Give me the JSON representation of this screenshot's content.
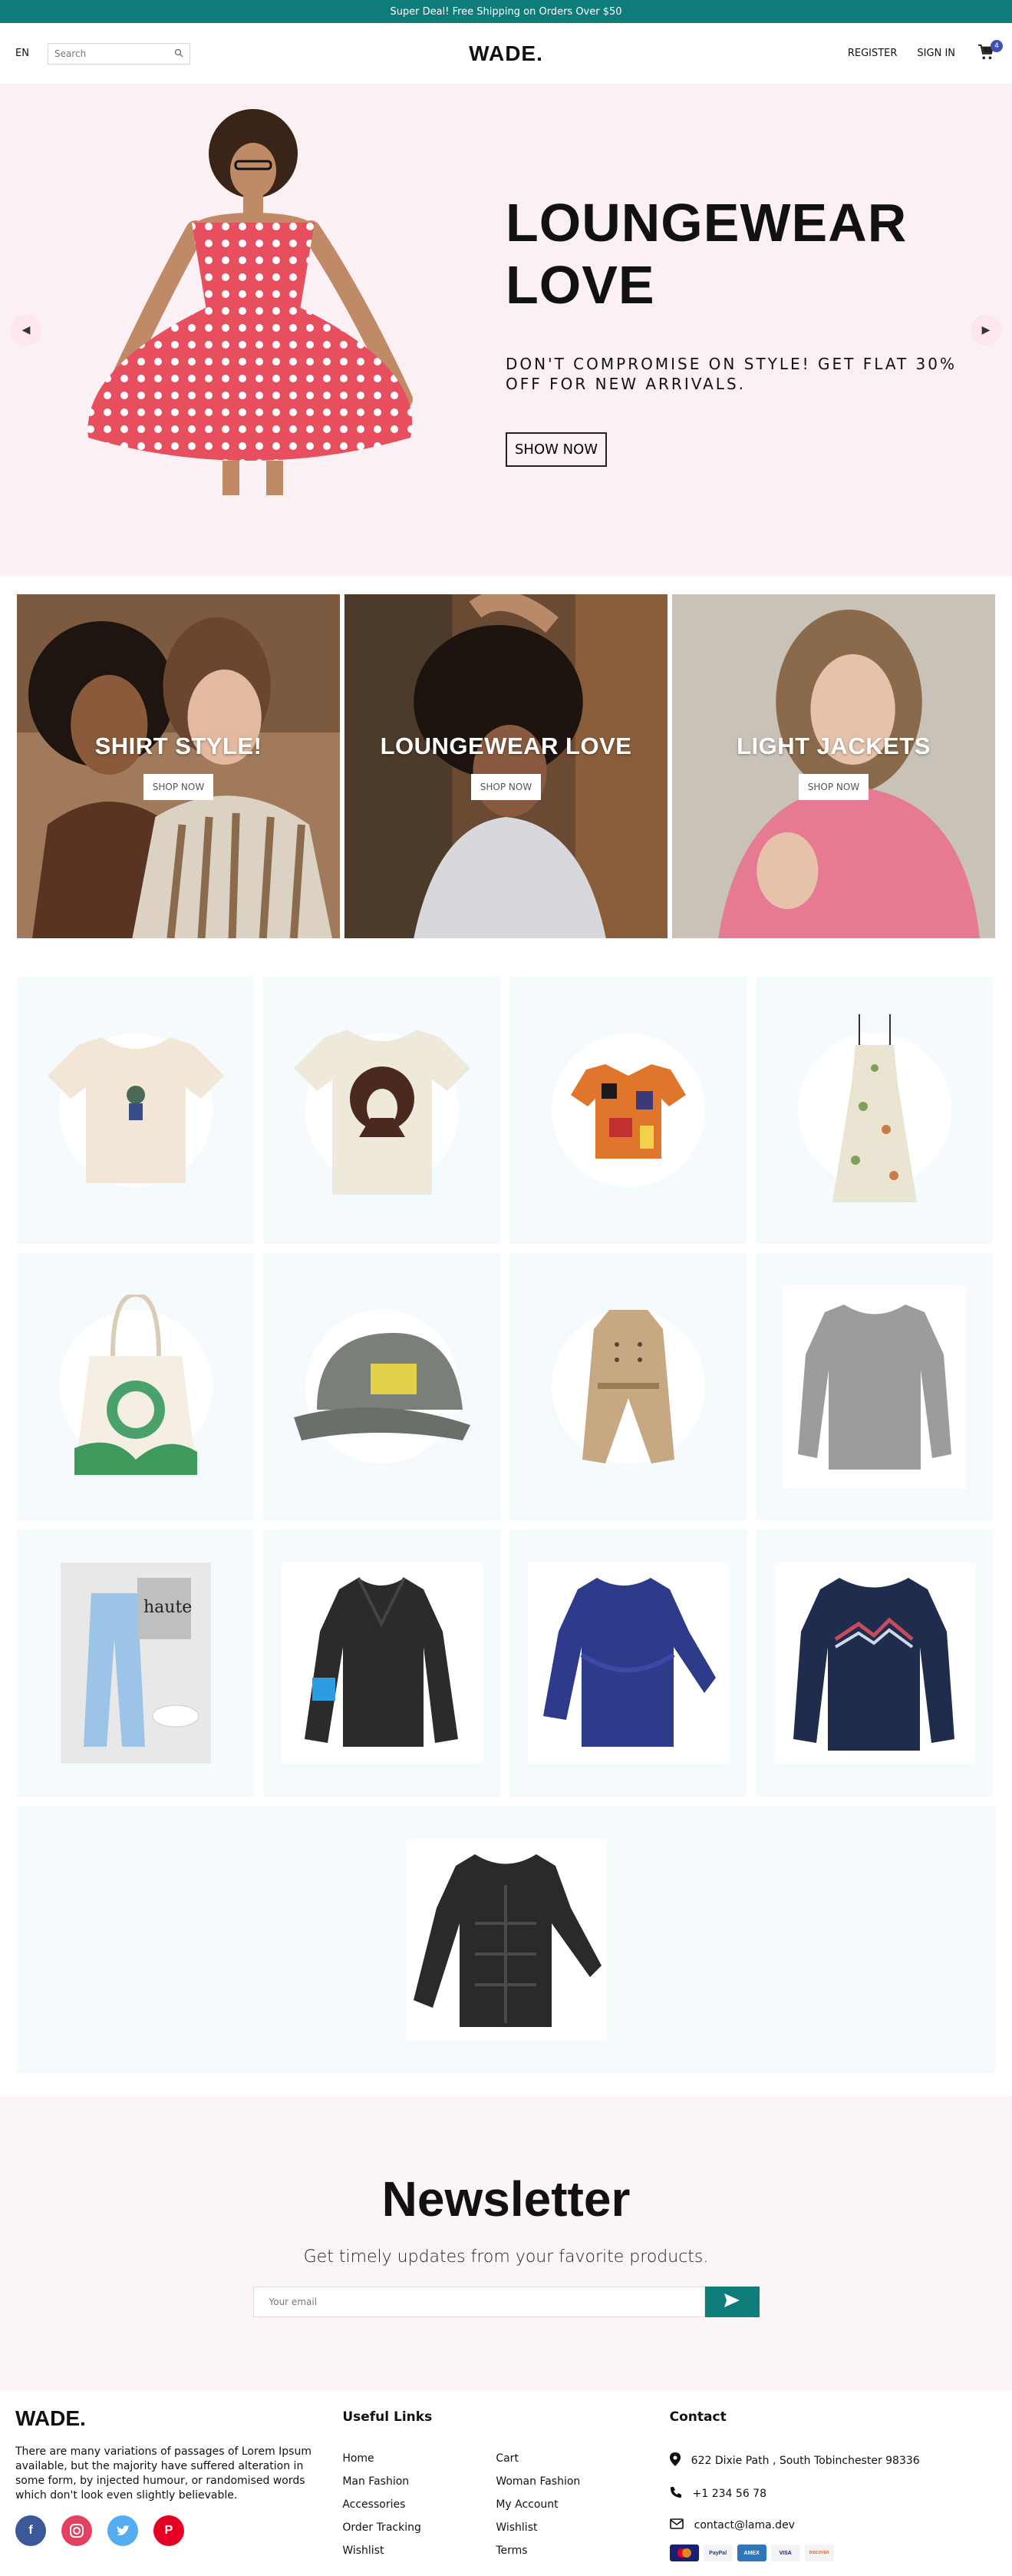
{
  "announcement": "Super Deal! Free Shipping on Orders Over $50",
  "navbar": {
    "language": "EN",
    "search_placeholder": "Search",
    "logo": "WADE.",
    "register": "REGISTER",
    "sign_in": "SIGN IN",
    "cart_count": "4"
  },
  "hero": {
    "title_line1": "LOUNGEWEAR",
    "title_line2": "LOVE",
    "description": "DON'T COMPROMISE ON STYLE! GET FLAT 30% OFF FOR NEW ARRIVALS.",
    "button": "SHOW NOW"
  },
  "categories": [
    {
      "title": "SHIRT STYLE!",
      "button": "SHOP NOW"
    },
    {
      "title": "LOUNGEWEAR LOVE",
      "button": "SHOP NOW"
    },
    {
      "title": "LIGHT JACKETS",
      "button": "SHOP NOW"
    }
  ],
  "newsletter": {
    "title": "Newsletter",
    "description": "Get timely updates from your favorite products.",
    "email_placeholder": "Your email"
  },
  "footer": {
    "logo": "WADE.",
    "description": "There are many variations of passages of Lorem Ipsum available, but the majority have suffered alteration in some form, by injected humour, or randomised words which don't look even slightly believable.",
    "useful_links_title": "Useful Links",
    "links": [
      "Home",
      "Cart",
      "Man Fashion",
      "Woman Fashion",
      "Accessories",
      "My Account",
      "Order Tracking",
      "Wishlist",
      "Wishlist",
      "Terms"
    ],
    "contact_title": "Contact",
    "address": "622 Dixie Path , South Tobinchester 98336",
    "phone": "+1 234 56 78",
    "email": "contact@lama.dev",
    "payments": [
      "MC",
      "PayPal",
      "AMEX",
      "VISA",
      "DISCOVER"
    ]
  },
  "colors": {
    "teal": "#0e7d7a",
    "hero_bg": "#fbf0f4",
    "product_bg": "#f5fbfd",
    "newsletter_bg": "#fcf5f5",
    "facebook": "#3b5999",
    "instagram": "#e4405f",
    "twitter": "#55acee",
    "pinterest": "#e60023"
  }
}
